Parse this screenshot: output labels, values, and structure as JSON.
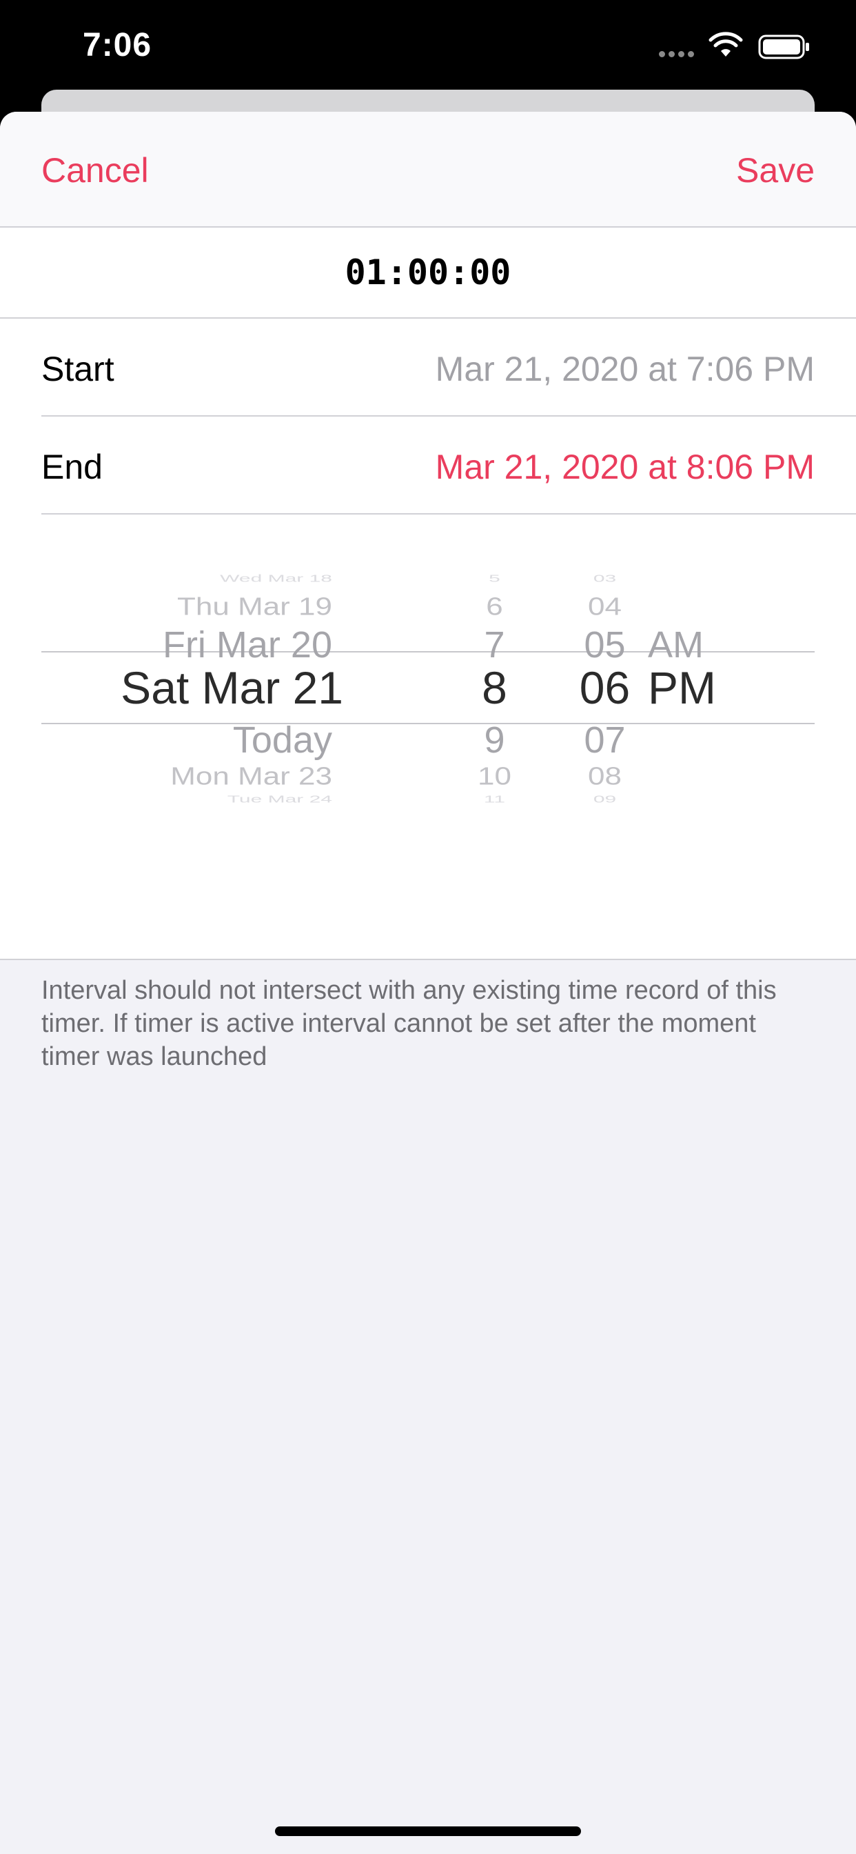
{
  "status_bar": {
    "time": "7:06"
  },
  "nav": {
    "cancel_label": "Cancel",
    "save_label": "Save"
  },
  "duration": "01:00:00",
  "start": {
    "label": "Start",
    "value": "Mar 21, 2020 at 7:06 PM"
  },
  "end": {
    "label": "End",
    "value": "Mar 21, 2020 at 8:06 PM"
  },
  "picker": {
    "days": [
      "Wed Mar 18",
      "Thu Mar 19",
      "Fri Mar 20",
      "Sat Mar 21",
      "Today",
      "Mon Mar 23",
      "Tue Mar 24"
    ],
    "hours": [
      "5",
      "6",
      "7",
      "8",
      "9",
      "10",
      "11"
    ],
    "minutes": [
      "03",
      "04",
      "05",
      "06",
      "07",
      "08",
      "09"
    ],
    "ampm": [
      "AM",
      "PM"
    ],
    "selected": {
      "day": "Sat Mar 21",
      "hour": "8",
      "minute": "06",
      "ampm": "PM"
    }
  },
  "footer_note": "Interval should not intersect with any existing time record of this timer. If timer is active interval cannot be set after the moment timer was launched",
  "colors": {
    "accent": "#ea3d5d",
    "secondary_text": "#a1a1a6",
    "sheet_background": "#f2f2f7"
  }
}
